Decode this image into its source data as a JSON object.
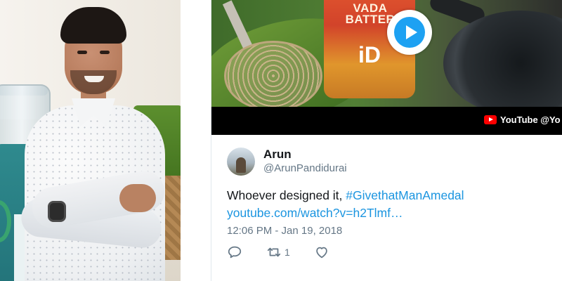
{
  "media": {
    "packet_brand": "VADA BATTER",
    "packet_logo": "iD",
    "source_badge": "YouTube @Yo"
  },
  "tweet": {
    "display_name": "Arun",
    "handle": "@ArunPandidurai",
    "text_prefix": "Whoever designed it, ",
    "hashtag": "#GivethatManAmedal",
    "link": "youtube.com/watch?v=h2Tlmf…",
    "timestamp": "12:06 PM - Jan 19, 2018",
    "retweet_count": "1"
  },
  "colors": {
    "link_blue": "#1b95e0",
    "play_blue": "#1da1f2",
    "muted_gray": "#657786",
    "youtube_red": "#ff0000"
  },
  "icons": [
    "play-icon",
    "youtube-icon",
    "reply-icon",
    "retweet-icon",
    "like-icon"
  ]
}
